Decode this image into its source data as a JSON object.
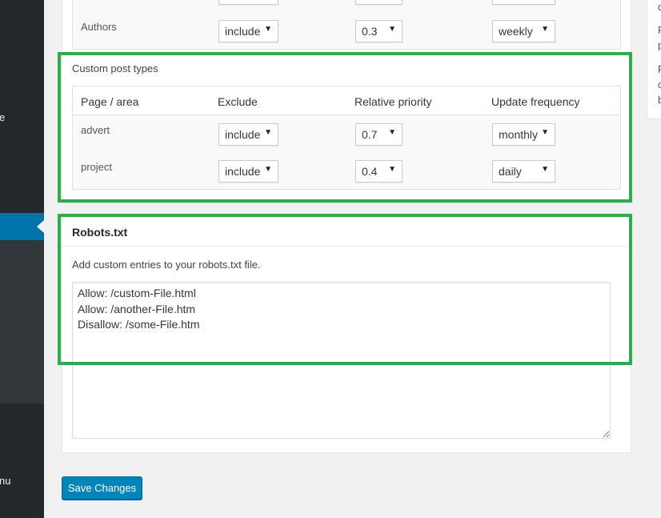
{
  "sidebar": {
    "fragment_top": "e",
    "fragment_bottom": "nu"
  },
  "side_box": {
    "fragments": [
      "d",
      "P",
      "p",
      "P",
      "c",
      "b"
    ]
  },
  "sitemap": {
    "authors_row": {
      "label": "Authors",
      "exclude": "include",
      "priority": "0.3",
      "frequency": "weekly"
    },
    "custom_post_types": {
      "title": "Custom post types",
      "headers": [
        "Page / area",
        "Exclude",
        "Relative priority",
        "Update frequency"
      ],
      "rows": [
        {
          "label": "advert",
          "exclude": "include",
          "priority": "0.7",
          "frequency": "monthly"
        },
        {
          "label": "project",
          "exclude": "include",
          "priority": "0.4",
          "frequency": "daily"
        }
      ]
    }
  },
  "robots": {
    "title": "Robots.txt",
    "description": "Add custom entries to your robots.txt file.",
    "content": "Allow: /custom-File.html\nAllow: /another-File.htm\nDisallow: /some-File.htm"
  },
  "actions": {
    "save_label": "Save Changes"
  },
  "colors": {
    "highlight": "#2fab4f",
    "primary_button": "#0085ba",
    "admin_menu": "#23282d",
    "admin_menu_current": "#0073aa"
  },
  "icons": {
    "select_caret": "▼"
  }
}
